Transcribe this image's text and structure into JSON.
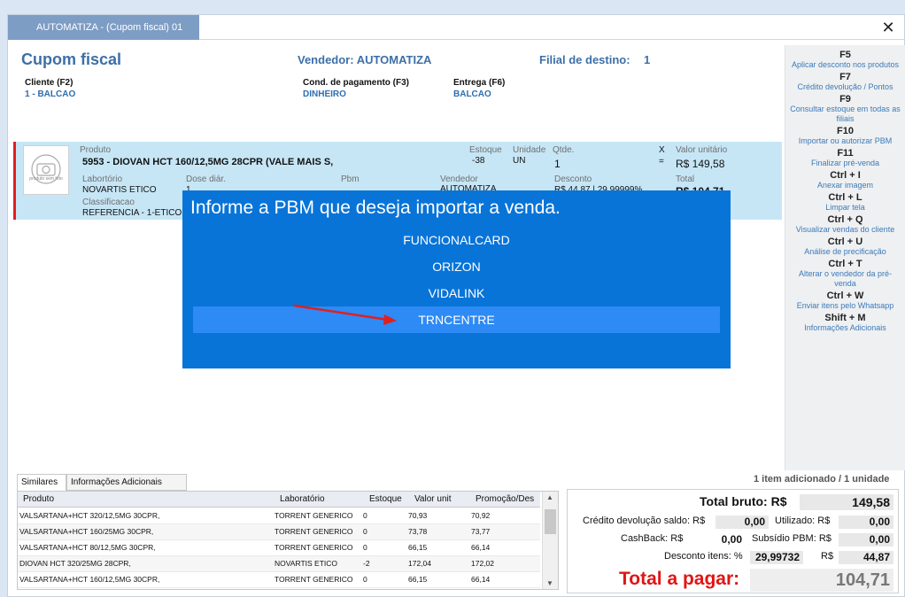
{
  "window": {
    "tab_title": "AUTOMATIZA - (Cupom fiscal) 01",
    "close_glyph": "✕"
  },
  "header": {
    "title": "Cupom fiscal",
    "vendedor": "Vendedor: AUTOMATIZA",
    "filial_label": "Filial de destino:",
    "filial_value": "1",
    "cliente_label": "Cliente (F2)",
    "cliente_value": "1 - BALCAO",
    "cond_label": "Cond. de pagamento (F3)",
    "cond_value": "DINHEIRO",
    "entrega_label": "Entrega (F6)",
    "entrega_value": "BALCAO"
  },
  "product": {
    "image_text": "produto sem foto",
    "produto_label": "Produto",
    "produto_value": "5953 - DIOVAN HCT 160/12,5MG 28CPR (VALE MAIS S,",
    "estoque_label": "Estoque",
    "estoque_value": "-38",
    "unidade_label": "Unidade",
    "unidade_value": "UN",
    "qtde_label": "Qtde.",
    "qtde_value": "1",
    "x_label": "X",
    "eq_label": "=",
    "valor_label": "Valor unitário",
    "valor_value": "R$ 149,58",
    "lab_label": "Labortório",
    "lab_value": "NOVARTIS ETICO",
    "dose_label": "Dose diár.",
    "dose_value": "1",
    "pbm_label": "Pbm",
    "vendedor_label": "Vendedor",
    "vendedor_value": "AUTOMATIZA",
    "desconto_label": "Desconto",
    "desconto_value": "R$ 44,87 | 29,99999%",
    "total_label": "Total",
    "total_value": "R$ 104,71",
    "class_label": "Classificacao",
    "class_value": "REFERENCIA - 1-ETICO P"
  },
  "overlay": {
    "title": "Informe a PBM que deseja importar a venda.",
    "options": [
      "FUNCIONALCARD",
      "ORIZON",
      "VIDALINK",
      "TRNCENTRE"
    ],
    "selected_index": 3,
    "colors": {
      "bg": "#0874d8",
      "selected": "#2e8af5",
      "arrow": "#e02020"
    }
  },
  "sidebar": [
    {
      "key": "F5",
      "desc": "Aplicar desconto nos produtos"
    },
    {
      "key": "F7",
      "desc": "Crédito devolução / Pontos"
    },
    {
      "key": "F9",
      "desc": "Consultar estoque em todas as filiais"
    },
    {
      "key": "F10",
      "desc": "Importar ou autorizar PBM"
    },
    {
      "key": "F11",
      "desc": "Finalizar pré-venda"
    },
    {
      "key": "Ctrl + I",
      "desc": "Anexar imagem"
    },
    {
      "key": "Ctrl + L",
      "desc": "Limpar tela"
    },
    {
      "key": "Ctrl + Q",
      "desc": "Visualizar vendas do cliente"
    },
    {
      "key": "Ctrl + U",
      "desc": "Análise de precificação"
    },
    {
      "key": "Ctrl + T",
      "desc": "Alterar o vendedor da pré-venda"
    },
    {
      "key": "Ctrl + W",
      "desc": "Enviar itens pelo Whatsapp"
    },
    {
      "key": "Shift + M",
      "desc": "Informações Adicionais"
    }
  ],
  "items_count": "1 item adicionado / 1 unidade",
  "tabs": [
    "Similares",
    "Informações Adicionais"
  ],
  "grid": {
    "headers": [
      "Produto",
      "Laboratório",
      "Estoque",
      "Valor unit",
      "Promoção/Des"
    ],
    "rows": [
      [
        "VALSARTANA+HCT 320/12,5MG 30CPR,",
        "TORRENT GENERICO",
        "0",
        "70,93",
        "70,92"
      ],
      [
        "VALSARTANA+HCT 160/25MG 30CPR,",
        "TORRENT GENERICO",
        "0",
        "73,78",
        "73,77"
      ],
      [
        "VALSARTANA+HCT  80/12,5MG 30CPR,",
        "TORRENT GENERICO",
        "0",
        "66,15",
        "66,14"
      ],
      [
        "DIOVAN HCT 320/25MG 28CPR,",
        "NOVARTIS ETICO",
        "-2",
        "172,04",
        "172,02"
      ],
      [
        "VALSARTANA+HCT 160/12,5MG 30CPR,",
        "TORRENT GENERICO",
        "0",
        "66,15",
        "66,14"
      ]
    ]
  },
  "totals": {
    "bruto_label": "Total bruto: R$",
    "bruto_value": "149,58",
    "credito_label": "Crédito devolução saldo: R$",
    "credito_value": "0,00",
    "utilizado_label": "Utilizado: R$",
    "utilizado_value": "0,00",
    "cashback_label": "CashBack: R$",
    "cashback_value": "0,00",
    "subsidio_label": "Subsídio PBM: R$",
    "subsidio_value": "0,00",
    "desc_label": "Desconto itens: %",
    "desc_pct": "29,99732",
    "desc_rs_label": "R$",
    "desc_value": "44,87",
    "pagar_label": "Total a pagar:",
    "pagar_value": "104,71"
  }
}
